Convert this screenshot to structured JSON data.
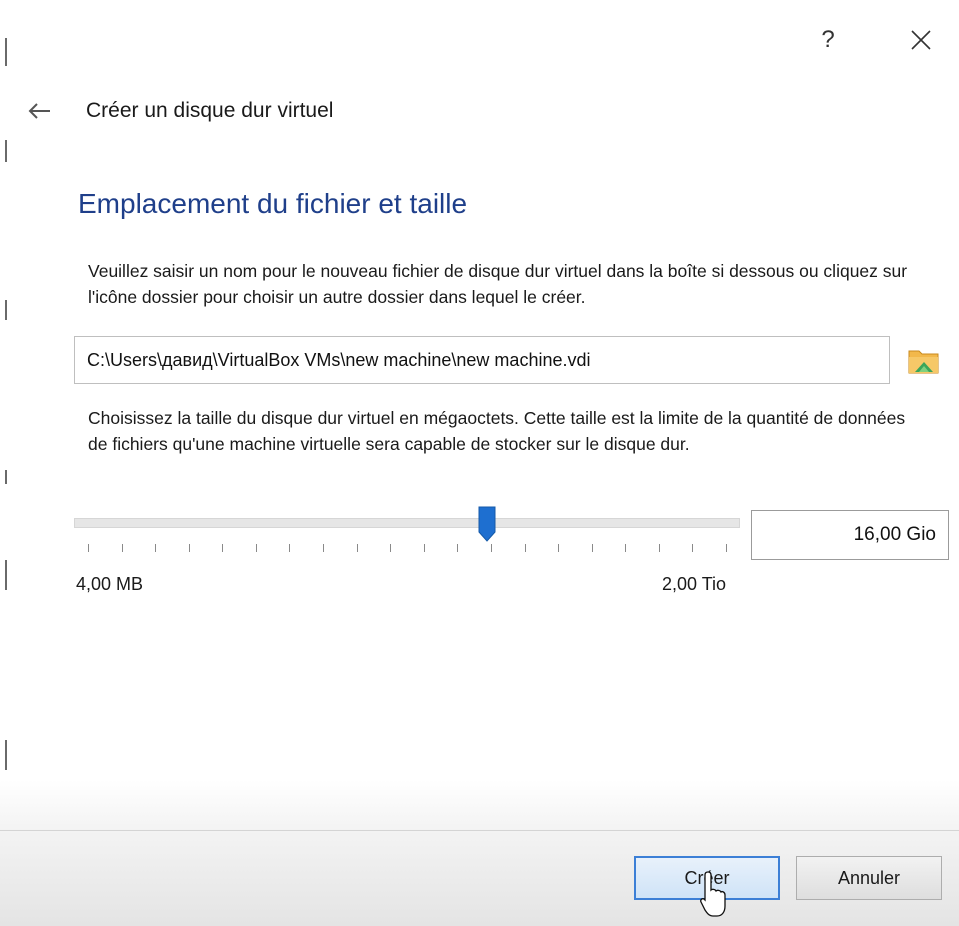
{
  "titlebar": {
    "help_label": "?",
    "close_icon": "close-icon"
  },
  "wizard": {
    "title": "Créer un disque dur virtuel",
    "back_icon": "arrow-left-icon"
  },
  "section": {
    "title": "Emplacement du fichier et taille",
    "location_description": "Veuillez saisir un nom pour le nouveau fichier de disque dur virtuel dans la boîte si dessous ou cliquez sur l'icône dossier pour choisir un autre dossier dans lequel le créer.",
    "file_path": "C:\\Users\\давид\\VirtualBox VMs\\new machine\\new machine.vdi",
    "folder_icon": "folder-icon",
    "size_description": "Choisissez la taille du disque dur virtuel en mégaoctets. Cette taille est la limite de la quantité de données de fichiers qu'une machine virtuelle sera capable de stocker sur le disque dur."
  },
  "size_slider": {
    "min_label": "4,00 MB",
    "max_label": "2,00 Tio",
    "position_fraction": 0.625,
    "tick_count": 20,
    "value_text": "16,00 Gio",
    "handle_color": "#1e6fd0"
  },
  "buttons": {
    "create_label": "Créer",
    "cancel_label": "Annuler"
  },
  "colors": {
    "section_title": "#1f3f8a",
    "accent": "#3c7fd6"
  }
}
